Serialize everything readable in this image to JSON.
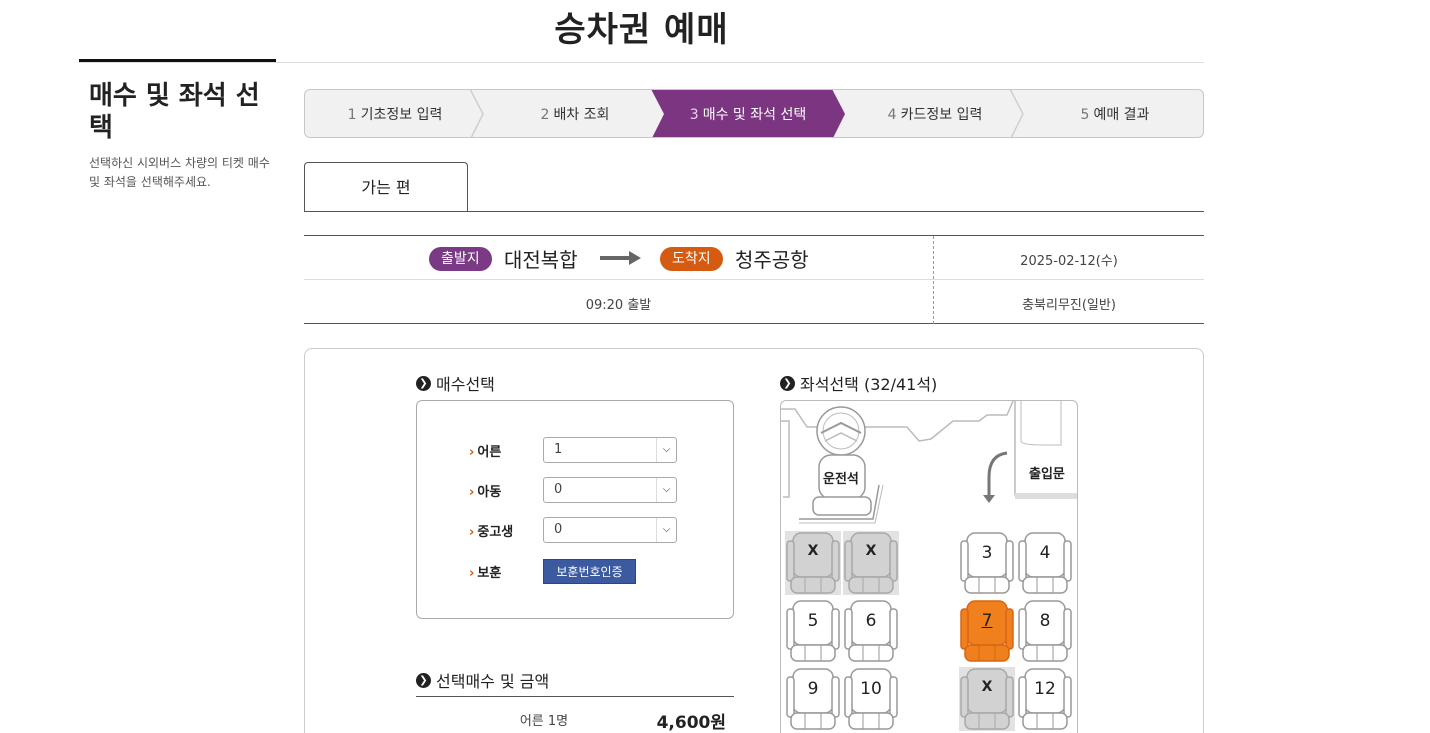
{
  "page": {
    "title": "승차권 예매"
  },
  "sidebar": {
    "title": "매수 및 좌석 선택",
    "description": "선택하신 시외버스 차량의 티켓 매수 및 좌석을 선택해주세요."
  },
  "steps": [
    {
      "num": "1",
      "label": "기초정보 입력",
      "active": false
    },
    {
      "num": "2",
      "label": "배차 조회",
      "active": false
    },
    {
      "num": "3",
      "label": "매수 및 좌석 선택",
      "active": true
    },
    {
      "num": "4",
      "label": "카드정보 입력",
      "active": false
    },
    {
      "num": "5",
      "label": "예매 결과",
      "active": false
    }
  ],
  "tab": {
    "label": "가는 편"
  },
  "route": {
    "departure_badge": "출발지",
    "departure": "대전복합",
    "arrival_badge": "도착지",
    "arrival": "청주공항",
    "date": "2025-02-12(수)",
    "depart_time": "09:20 출발",
    "company": "충북리무진(일반)"
  },
  "quantity": {
    "title": "매수선택",
    "rows": [
      {
        "label": "어른",
        "value": "1"
      },
      {
        "label": "아동",
        "value": "0"
      },
      {
        "label": "중고생",
        "value": "0"
      }
    ],
    "veteran_label": "보훈",
    "veteran_button": "보훈번호인증"
  },
  "seat_section": {
    "title": "좌석선택 (32/41석)",
    "driver_label": "운전석",
    "door_label": "출입문",
    "seats": [
      {
        "label": "X",
        "state": "taken"
      },
      {
        "label": "X",
        "state": "taken"
      },
      {
        "label": "3",
        "state": "available"
      },
      {
        "label": "4",
        "state": "available"
      },
      {
        "label": "5",
        "state": "available"
      },
      {
        "label": "6",
        "state": "available"
      },
      {
        "label": "7",
        "state": "selected"
      },
      {
        "label": "8",
        "state": "available"
      },
      {
        "label": "9",
        "state": "available"
      },
      {
        "label": "10",
        "state": "available"
      },
      {
        "label": "X",
        "state": "taken"
      },
      {
        "label": "12",
        "state": "available"
      }
    ]
  },
  "summary": {
    "title": "선택매수 및 금액",
    "label": "어른 1명",
    "amount": "4,600원"
  },
  "colors": {
    "active_step": "#7b3581",
    "departure_badge": "#7a3a86",
    "arrival_badge": "#d55a12",
    "selected_seat": "#f07f1e",
    "taken_seat": "#d2d2d2",
    "verify_button": "#3c5a9f"
  }
}
